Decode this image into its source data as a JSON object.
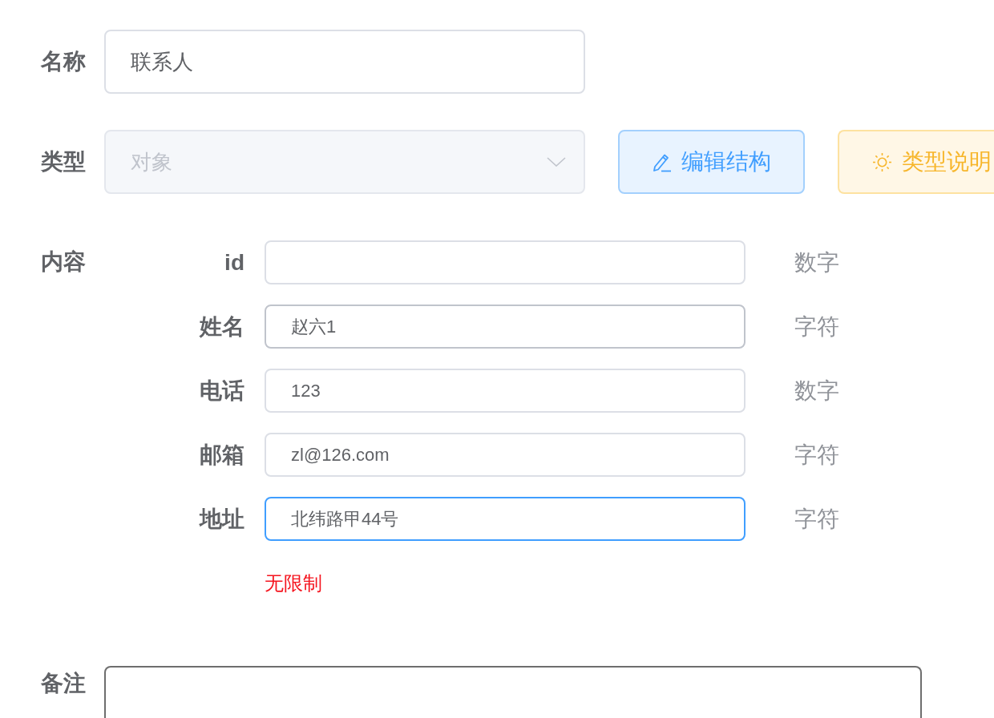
{
  "form": {
    "name": {
      "label": "名称",
      "value": "联系人"
    },
    "type": {
      "label": "类型",
      "value": "对象",
      "disabled": true
    },
    "buttons": [
      {
        "label": "编辑结构",
        "kind": "primary"
      },
      {
        "label": "类型说明",
        "kind": "warning"
      }
    ],
    "content": {
      "label": "内容",
      "fields": [
        {
          "label": "id",
          "data_type": "数字",
          "focused": false,
          "hovered": false
        },
        {
          "label": "姓名",
          "value": "赵六1",
          "data_type": "字符",
          "focused": false,
          "hovered": true
        },
        {
          "label": "电话",
          "value": "123",
          "data_type": "数字",
          "focused": false,
          "hovered": false
        },
        {
          "label": "邮箱",
          "value": "zl@126.com",
          "data_type": "字符",
          "focused": false,
          "hovered": false
        },
        {
          "label": "地址",
          "value": "北纬路甲44号",
          "data_type": "字符",
          "focused": true,
          "hovered": false
        }
      ],
      "note": "无限制"
    },
    "remark": {
      "label": "备注"
    }
  }
}
